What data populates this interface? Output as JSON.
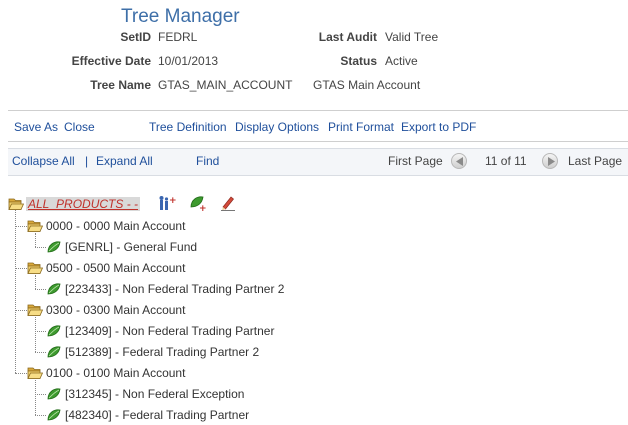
{
  "header": {
    "title": "Tree Manager",
    "setid_label": "SetID",
    "setid_value": "FEDRL",
    "last_audit_label": "Last Audit",
    "last_audit_value": "Valid Tree",
    "effective_date_label": "Effective Date",
    "effective_date_value": "10/01/2013",
    "status_label": "Status",
    "status_value": "Active",
    "tree_name_label": "Tree Name",
    "tree_name_value": "GTAS_MAIN_ACCOUNT",
    "tree_description": "GTAS Main Account"
  },
  "actions": {
    "save_as": "Save As",
    "close": "Close",
    "tree_definition": "Tree Definition",
    "display_options": "Display Options",
    "print_format": "Print Format",
    "export_pdf": "Export to PDF"
  },
  "navbar": {
    "collapse_all": "Collapse All",
    "separator": "|",
    "expand_all": "Expand All",
    "find": "Find",
    "first_page": "First Page",
    "page_info": "11 of 11",
    "last_page": "Last Page"
  },
  "tree": {
    "root": "ALL_PRODUCTS - -",
    "nodes": [
      {
        "label": "0000 - 0000 Main Account",
        "leaves": [
          "[GENRL] - General Fund"
        ]
      },
      {
        "label": "0500 - 0500 Main Account",
        "leaves": [
          "[223433] - Non Federal Trading Partner 2"
        ]
      },
      {
        "label": "0300 - 0300 Main Account",
        "leaves": [
          "[123409] - Non Federal Trading Partner",
          "[512389] - Federal Trading Partner 2"
        ]
      },
      {
        "label": "0100 - 0100 Main Account",
        "leaves": [
          "[312345] - Non Federal Exception",
          "[482340] - Federal Trading Partner"
        ]
      }
    ]
  },
  "colors": {
    "title": "#3e6fa8",
    "link": "#1f4f9b",
    "root_label": "#c0302a",
    "folder": "#e8c25a",
    "leaf": "#3d9a2e"
  },
  "icons": [
    "folder-open-icon",
    "leaf-icon",
    "insert-child-icon",
    "insert-leaf-icon",
    "edit-pencil-icon",
    "previous-page-icon",
    "next-page-icon"
  ]
}
